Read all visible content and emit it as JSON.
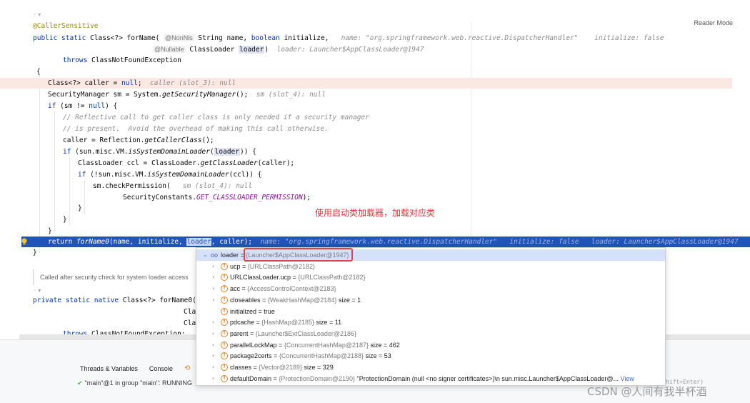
{
  "editor": {
    "reader_mode": "Reader Mode",
    "annotation_caller": "@CallerSensitive",
    "decl1_a": "public static ",
    "decl1_b": "Class<?> forName(",
    "nonnls": "@NonNls",
    "decl1_c": " String name, ",
    "decl1_d": "boolean",
    "decl1_e": " initialize,",
    "decl1_hint_name": "name: \"org.springframework.web.reactive.DispatcherHandler\"",
    "decl1_hint_init": "initialize: false",
    "nullable": "@Nullable",
    "decl2_a": " ClassLoader ",
    "decl2_loader": "loader",
    "decl2_b": ")",
    "decl2_hint": "loader: Launcher$AppClassLoader@1947",
    "throws_kw": "throws",
    "throws_rest": " ClassNotFoundException",
    "brace_open": "{",
    "l_caller_a": "Class<?> caller = ",
    "l_caller_null": "null",
    "l_caller_b": ";",
    "l_caller_hint": "caller (slot_3): null",
    "l_sm_a": "SecurityManager sm = System.",
    "l_sm_it": "getSecurityManager",
    "l_sm_b": "();",
    "l_sm_hint": "sm (slot_4): null",
    "l_if1_kw": "if",
    "l_if1_a": " (sm != ",
    "l_if1_null": "null",
    "l_if1_b": ") {",
    "cmt1": "// Reflective call to get caller class is only needed if a security manager",
    "cmt2": "// is present.  Avoid the overhead of making this call otherwise.",
    "l_refl_a": "caller = Reflection.",
    "l_refl_it": "getCallerClass",
    "l_refl_b": "();",
    "l_if2_kw": "if",
    "l_if2_a": " (sun.misc.VM.",
    "l_if2_it": "isSystemDomainLoader",
    "l_if2_b": "(",
    "l_if2_loader": "loader",
    "l_if2_c": ")) {",
    "l_ccl_a": "ClassLoader ccl = ClassLoader.",
    "l_ccl_it": "getClassLoader",
    "l_ccl_b": "(caller);",
    "l_if3_kw": "if",
    "l_if3_a": " (!sun.misc.VM.",
    "l_if3_it": "isSystemDomainLoader",
    "l_if3_b": "(ccl)) {",
    "l_check_a": "sm.checkPermission(",
    "l_check_hint": "sm (slot_4): null",
    "l_perm_a": "SecurityConstants.",
    "l_perm_const": "GET_CLASSLOADER_PERMISSION",
    "l_perm_b": ");",
    "brace_close": "}",
    "ret_kw": "return ",
    "ret_fn": "forName0",
    "ret_a": "(name, initialize, ",
    "ret_loader": "loader",
    "ret_b": ", caller);",
    "ret_hint_name": "name: \"org.springframework.web.reactive.DispatcherHandler\"",
    "ret_hint_init": "initialize: false",
    "ret_hint_loader": "loader: Launcher$AppClassLoader@1947",
    "ret_hint_caller": "calle",
    "chinese_note": "使用启动类加载器，加载对应类",
    "doc_text": "Called after security check for system loader access",
    "native_a": "private static native ",
    "native_b": "Class<?> forName0(Str",
    "cla1": "Cla",
    "cla2": "Cla",
    "throws2_kw": "throws",
    "throws2_rest": " ClassNotFoundException;"
  },
  "popup": {
    "rows": [
      {
        "name": "loader",
        "value": "{Launcher$AppClassLoader@1947}",
        "extra": "",
        "icon": "object-icon",
        "expanded": true
      },
      {
        "name": "ucp",
        "value": "{URLClassPath@2182}",
        "extra": "",
        "icon": "field-icon"
      },
      {
        "name": "URLClassLoader.ucp",
        "value": "{URLClassPath@2182}",
        "extra": "",
        "icon": "field-icon"
      },
      {
        "name": "acc",
        "value": "{AccessControlContext@2183}",
        "extra": "",
        "icon": "field-icon"
      },
      {
        "name": "closeables",
        "value": "{WeakHashMap@2184}",
        "extra": "size = 1",
        "icon": "field-icon"
      },
      {
        "name": "initialized",
        "value": "true",
        "extra": "",
        "icon": "field-icon"
      },
      {
        "name": "pdcache",
        "value": "{HashMap@2185}",
        "extra": "size = 11",
        "icon": "field-icon"
      },
      {
        "name": "parent",
        "value": "{Launcher$ExtClassLoader@2186}",
        "extra": "",
        "icon": "field-icon"
      },
      {
        "name": "parallelLockMap",
        "value": "{ConcurrentHashMap@2187}",
        "extra": "size = 462",
        "icon": "field-icon"
      },
      {
        "name": "package2certs",
        "value": "{ConcurrentHashMap@2188}",
        "extra": "size = 53",
        "icon": "field-icon"
      },
      {
        "name": "classes",
        "value": "{Vector@2189}",
        "extra": "size = 329",
        "icon": "field-icon"
      },
      {
        "name": "defaultDomain",
        "value": "{ProtectionDomain@2190}",
        "extra": "\"ProtectionDomain  (null <no signer certificates>)\\n sun.misc.Launcher$AppClassLoader@...",
        "view": "View",
        "icon": "field-icon"
      }
    ]
  },
  "bottom": {
    "tab_threads": "Threads & Variables",
    "tab_console": "Console",
    "thread_line": "\"main\"@1 in group \"main\": RUNNING",
    "shortcut": "trl+Shift+Enter)"
  },
  "watermark": "CSDN @人间有我半杯酒",
  "colors": {
    "exec_line": "#2154b8",
    "caller_highlight": "#fce8e2",
    "selection_box": "#e04050",
    "note_red": "#e0333a"
  }
}
